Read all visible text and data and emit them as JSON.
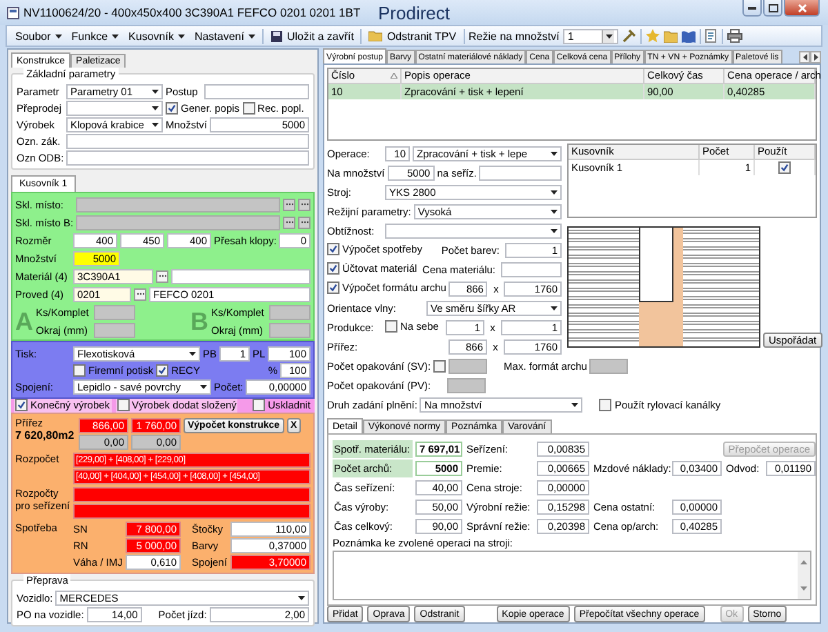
{
  "window": {
    "title": "NV1100624/20 - 400x450x400 3C390A1 FEFCO 0201 0201 1BT",
    "app_name": "Prodirect"
  },
  "menu": [
    "Soubor",
    "Funkce",
    "Kusovník",
    "Nastavení"
  ],
  "toolbar": {
    "save": "Uložit a zavřít",
    "delete": "Odstranit TPV",
    "overhead_label": "Režie na množství",
    "overhead_value": "1"
  },
  "left_tabs": [
    {
      "label": "Konstrukce",
      "selected": true
    },
    {
      "label": "Paletizace",
      "selected": false
    }
  ],
  "basic": {
    "title": "Základní parametry",
    "parametr_label": "Parametr",
    "parametr": "Parametry 01",
    "postup_label": "Postup",
    "preprodej_label": "Přeprodej",
    "gener_popis": {
      "label": "Gener. popis",
      "checked": true
    },
    "rec_popl": {
      "label": "Rec. popl.",
      "checked": false
    },
    "vyrobek_label": "Výrobek",
    "vyrobek": "Klopová krabice",
    "mnozstvi_label": "Množství",
    "mnozstvi": "5000",
    "ozn_zak_label": "Ozn. zák.",
    "ozn_odb_label": "Ozn ODB:"
  },
  "bom_tabs": [
    {
      "label": "Kusovník 1",
      "selected": true
    }
  ],
  "green": {
    "skl_misto_label": "Skl. místo:",
    "skl_misto_b_label": "Skl. místo B:",
    "rozmer_label": "Rozměr",
    "rozmer": [
      "400",
      "450",
      "400"
    ],
    "presah_label": "Přesah klopy:",
    "presah": "0",
    "mnozstvi_label": "Množství",
    "mnozstvi": "5000",
    "material_label": "Materiál (4)",
    "material": "3C390A1",
    "proved_label": "Proved (4)",
    "proved": "0201",
    "proved_name": "FEFCO 0201",
    "side_a": {
      "letter": "A",
      "ks_label": "Ks/Komplet",
      "okraj_label": "Okraj (mm)"
    },
    "side_b": {
      "letter": "B",
      "ks_label": "Ks/Komplet",
      "okraj_label": "Okraj (mm)"
    }
  },
  "print": {
    "tisk_label": "Tisk:",
    "tisk": "Flexotisková",
    "pb_label": "PB",
    "pb": "1",
    "pl_label": "PL",
    "pl": "100",
    "firemni_potisk": {
      "label": "Firemní potisk",
      "checked": false
    },
    "recy": {
      "label": "RECY",
      "checked": true
    },
    "pct_label": "%",
    "pct": "100",
    "spojeni_label": "Spojení:",
    "spojeni": "Lepidlo - savé povrchy",
    "pocet_label": "Počet:",
    "pocet": "0,00000"
  },
  "flags": [
    {
      "label": "Konečný výrobek",
      "checked": true
    },
    {
      "label": "Výrobek dodat složený",
      "checked": false
    },
    {
      "label": "Uskladnit",
      "checked": false
    }
  ],
  "construction": {
    "prirez_label": "Přířez",
    "area": "7 620,80m2",
    "prirez": [
      "866,00",
      "1 760,00"
    ],
    "prirez_alt": [
      "0,00",
      "0,00"
    ],
    "calc_button": "Výpočet konstrukce",
    "close_button": "X",
    "rozpocet_label": "Rozpočet",
    "rozpocet": [
      "[229,00] + [408,00] + [229,00]",
      "[40,00] + [404,00] + [454,00] + [408,00] + [454,00]"
    ],
    "rozpocty_label": "Rozpočty pro seřízení",
    "spotreba_label": "Spotřeba",
    "consumption": [
      {
        "label": "SN",
        "value": "7 800,00",
        "alert": true,
        "label2": "Štočky",
        "value2": "110,00",
        "alert2": false
      },
      {
        "label": "RN",
        "value": "5 000,00",
        "alert": true,
        "label2": "Barvy",
        "value2": "0,37000",
        "alert2": false
      },
      {
        "label": "Váha / IMJ",
        "value": "0,610",
        "alert": false,
        "label2": "Spojení",
        "value2": "3,70000",
        "alert2": true
      }
    ]
  },
  "transport": {
    "title": "Přeprava",
    "vozidlo_label": "Vozidlo:",
    "vozidlo": "MERCEDES",
    "po_label": "PO na vozidle:",
    "po": "14,00",
    "jizdy_label": "Počet jízd:",
    "jizdy": "2,00"
  },
  "right_tabs": [
    {
      "label": "Výrobní postup",
      "selected": true
    },
    {
      "label": "Barvy",
      "selected": false
    },
    {
      "label": "Ostatní materiálové náklady",
      "selected": false
    },
    {
      "label": "Cena",
      "selected": false
    },
    {
      "label": "Celková cena",
      "selected": false
    },
    {
      "label": "Přílohy",
      "selected": false
    },
    {
      "label": "TN + VN + Poznámky",
      "selected": false
    },
    {
      "label": "Paletové lis",
      "selected": false
    }
  ],
  "operations": {
    "columns": [
      "Číslo",
      "Popis operace",
      "Celkový čas",
      "Cena operace / arch"
    ],
    "rows": [
      {
        "cells": [
          "10",
          "Zpracování + tisk + lepení",
          "90,00",
          "0,40285"
        ],
        "selected": true
      }
    ]
  },
  "operation_form": {
    "operace_label": "Operace:",
    "operace": "10",
    "operace_name": "Zpracování + tisk + lepe",
    "na_mnozstvi_label": "Na množství",
    "na_mnozstvi": "5000",
    "na_serizeni_label": "na seříz.",
    "stroj_label": "Stroj:",
    "stroj": "YKS 2800",
    "rezie_label": "Režijní parametry:",
    "rezie": "Vysoká",
    "obtiznost_label": "Obtížnost:",
    "vypocet_spotreby": {
      "label": "Výpočet spotřeby",
      "checked": true
    },
    "pocet_barev_label": "Počet barev:",
    "pocet_barev": "1",
    "uctovat_material": {
      "label": "Účtovat materiál",
      "checked": true
    },
    "cena_materialu_label": "Cena materiálu:",
    "vypocet_formatu": {
      "label": "Výpočet formátu archu",
      "checked": true
    },
    "format": [
      "866",
      "1760"
    ],
    "format_x": "x",
    "orientace_label": "Orientace vlny:",
    "orientace": "Ve směru šířky AR",
    "produkce_label": "Produkce:",
    "na_sebe": {
      "label": "Na sebe",
      "checked": false
    },
    "produkce": [
      "1",
      "1"
    ],
    "produkce_x": "x",
    "prirez_label": "Přířez:",
    "prirez": [
      "866",
      "1760"
    ],
    "prirez_x": "x",
    "opak_sv_label": "Počet opakování (SV):",
    "opak_sv_check": {
      "checked": false
    },
    "max_format_label": "Max. formát archu",
    "opak_pv_label": "Počet opakování (PV):",
    "druh_label": "Druh zadání plnění:",
    "druh": "Na množství",
    "rylovaci": {
      "label": "Použít rylovací kanálky",
      "checked": false
    }
  },
  "bom_grid": {
    "columns": [
      "Kusovník",
      "Počet",
      "Použít"
    ],
    "rows": [
      {
        "name": "Kusovník 1",
        "count": "1",
        "use": true
      }
    ]
  },
  "arrange_button": "Uspořádat",
  "detail_tabs": [
    {
      "label": "Detail",
      "selected": true
    },
    {
      "label": "Výkonové normy",
      "selected": false
    },
    {
      "label": "Poznámka",
      "selected": false
    },
    {
      "label": "Varování",
      "selected": false
    }
  ],
  "detail": {
    "recalc_button": "Přepočet operace",
    "rows": [
      {
        "cells": [
          {
            "label": "Spotř. materiálu:",
            "value": "7 697,01",
            "highlighted": true
          },
          {
            "label": "Seřízení:",
            "value": "0,00835",
            "highlighted": false
          }
        ]
      },
      {
        "cells": [
          {
            "label": "Počet archů:",
            "value": "5000",
            "highlighted": true
          },
          {
            "label": "Premie:",
            "value": "0,00665",
            "highlighted": false
          },
          {
            "label": "Mzdové náklady:",
            "value": "0,03400",
            "highlighted": false
          },
          {
            "label": "Odvod:",
            "value": "0,01190",
            "highlighted": false
          }
        ]
      },
      {
        "cells": [
          {
            "label": "Čas seřízení:",
            "value": "40,00",
            "highlighted": false
          },
          {
            "label": "Cena stroje:",
            "value": "0,00000",
            "highlighted": false
          }
        ]
      },
      {
        "cells": [
          {
            "label": "Čas výroby:",
            "value": "50,00",
            "highlighted": false
          },
          {
            "label": "Výrobní režie:",
            "value": "0,15298",
            "highlighted": false
          },
          {
            "label": "Cena ostatní:",
            "value": "0,00000",
            "highlighted": false
          }
        ]
      },
      {
        "cells": [
          {
            "label": "Čas celkový:",
            "value": "90,00",
            "highlighted": false
          },
          {
            "label": "Správní režie:",
            "value": "0,20398",
            "highlighted": false
          },
          {
            "label": "Cena op/arch:",
            "value": "0,40285",
            "highlighted": false
          }
        ]
      }
    ],
    "note_label": "Poznámka ke zvolené operaci na stroji:"
  },
  "buttons": [
    {
      "label": "Přidat",
      "disabled": false
    },
    {
      "label": "Oprava",
      "disabled": false
    },
    {
      "label": "Odstranit",
      "disabled": false
    },
    {
      "label": "Kopie operace",
      "disabled": false
    },
    {
      "label": "Přepočítat všechny operace",
      "disabled": false
    },
    {
      "label": "Ok",
      "disabled": true
    },
    {
      "label": "Storno",
      "disabled": false
    }
  ]
}
